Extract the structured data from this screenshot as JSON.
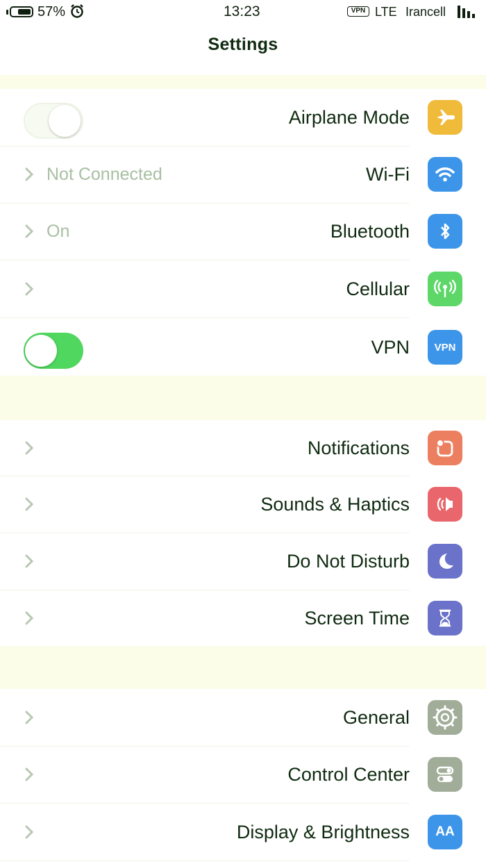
{
  "status_bar": {
    "battery": "57%",
    "time": "13:23",
    "network": "LTE",
    "vpn_badge": "VPN",
    "carrier": "Irancell"
  },
  "nav": {
    "title": "Settings"
  },
  "groups": [
    {
      "items": [
        {
          "label": "Airplane Mode",
          "control": "toggle",
          "state": "off",
          "icon": "airplane-icon",
          "icon_color": "#f0ba3a"
        },
        {
          "label": "Wi-Fi",
          "value": "Not Connected",
          "control": "chevron",
          "icon": "wifi-icon",
          "icon_color": "#3d95e9"
        },
        {
          "label": "Bluetooth",
          "value": "On",
          "control": "chevron",
          "icon": "bluetooth-icon",
          "icon_color": "#3d95e9"
        },
        {
          "label": "Cellular",
          "control": "chevron",
          "icon": "cellular-icon",
          "icon_color": "#5dd768"
        },
        {
          "label": "VPN",
          "control": "toggle",
          "state": "on",
          "icon": "vpn-icon",
          "icon_color": "#3d95e9",
          "icon_text": "VPN"
        }
      ]
    },
    {
      "items": [
        {
          "label": "Notifications",
          "control": "chevron",
          "icon": "notifications-icon",
          "icon_color": "#ec7f5f"
        },
        {
          "label": "Sounds & Haptics",
          "control": "chevron",
          "icon": "speaker-icon",
          "icon_color": "#e9676c"
        },
        {
          "label": "Do Not Disturb",
          "control": "chevron",
          "icon": "moon-icon",
          "icon_color": "#6b72c9"
        },
        {
          "label": "Screen Time",
          "control": "chevron",
          "icon": "hourglass-icon",
          "icon_color": "#6b72c9"
        }
      ]
    },
    {
      "items": [
        {
          "label": "General",
          "control": "chevron",
          "icon": "gear-icon",
          "icon_color": "#a1ad99"
        },
        {
          "label": "Control Center",
          "control": "chevron",
          "icon": "switches-icon",
          "icon_color": "#a1ad99"
        },
        {
          "label": "Display & Brightness",
          "control": "chevron",
          "icon": "text-size-icon",
          "icon_color": "#3d95e9",
          "icon_text": "AA"
        }
      ]
    }
  ]
}
